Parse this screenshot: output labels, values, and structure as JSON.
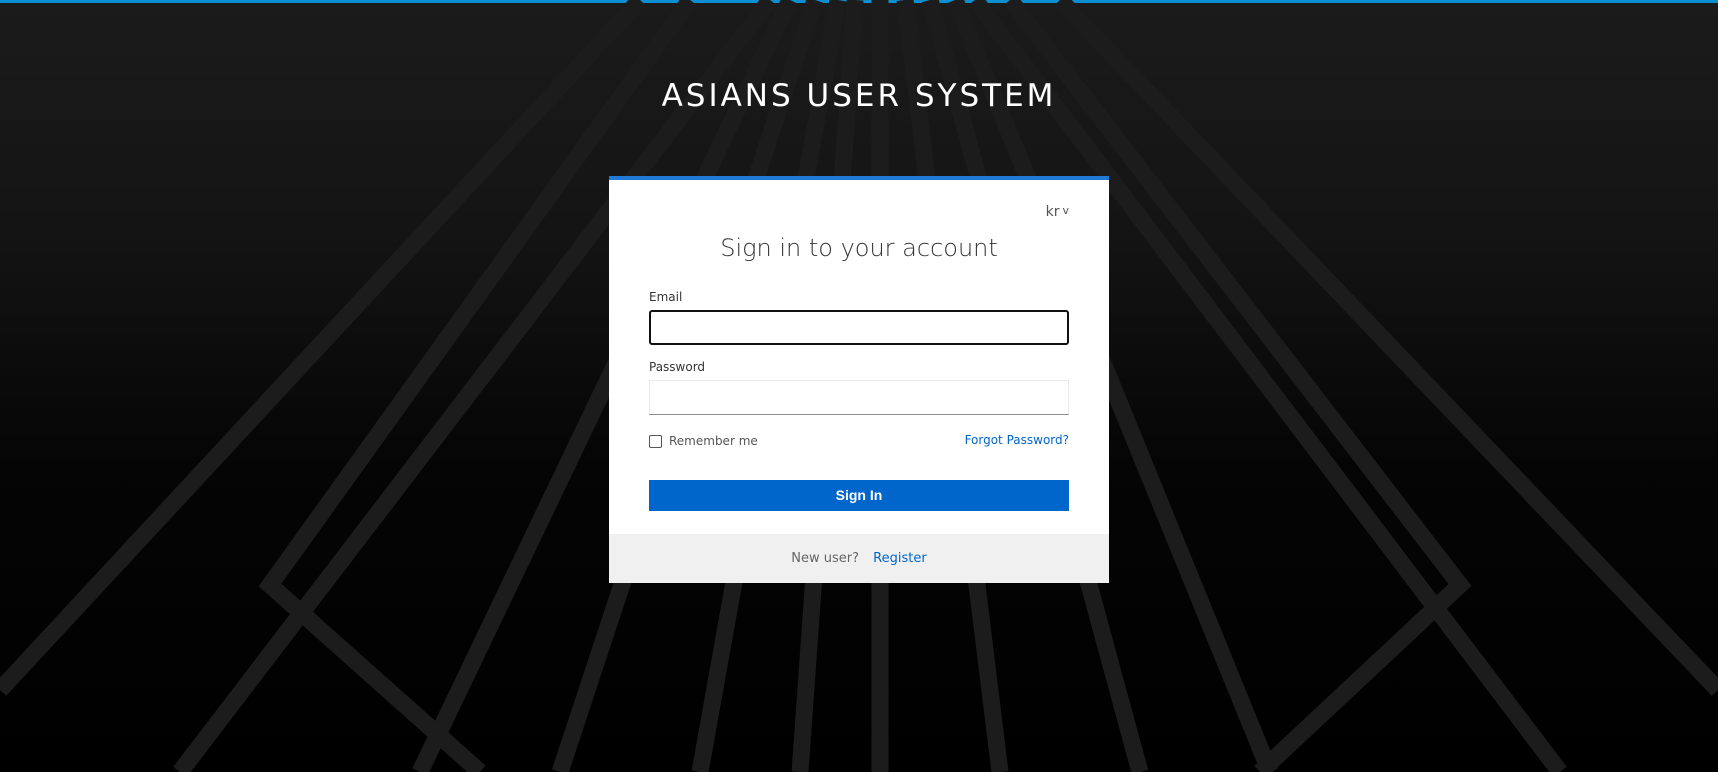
{
  "page": {
    "accent_color": "#0b8fd1",
    "brand_title": "ASIANS USER SYSTEM"
  },
  "login_card": {
    "top_border_color": "#1f7bd6",
    "language": {
      "selected": "kr",
      "icon": "chevron-down-icon"
    },
    "title": "Sign in to your account",
    "email": {
      "label": "Email",
      "value": "",
      "placeholder": ""
    },
    "password": {
      "label": "Password",
      "value": "",
      "placeholder": ""
    },
    "remember_me": {
      "label": "Remember me",
      "checked": false
    },
    "forgot_password_label": "Forgot Password?",
    "sign_in_label": "Sign In",
    "primary_color": "#0066cc",
    "footer": {
      "new_user_text": "New user?",
      "register_label": "Register"
    }
  }
}
